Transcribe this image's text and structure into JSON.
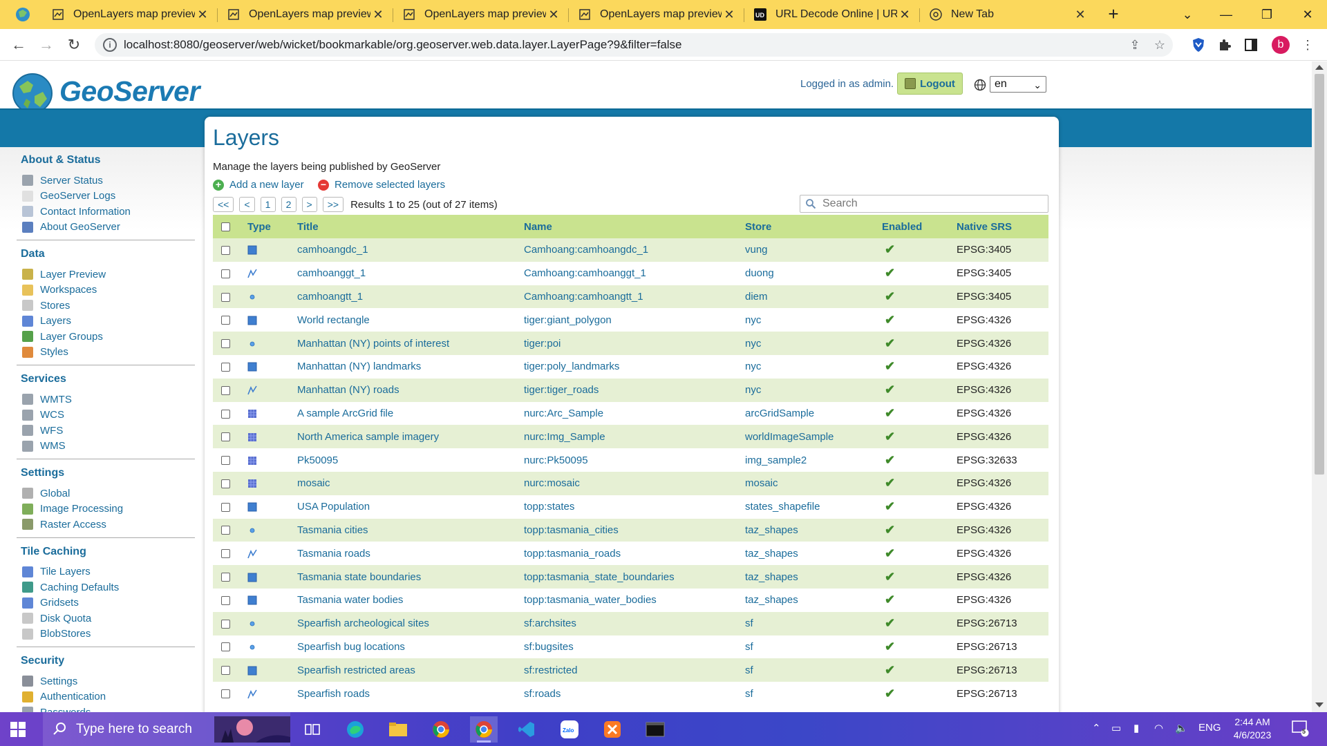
{
  "browser": {
    "tabs": [
      {
        "label": "OpenLayers map preview",
        "active": false
      },
      {
        "label": "OpenLayers map preview",
        "active": false
      },
      {
        "label": "OpenLayers map preview",
        "active": false
      },
      {
        "label": "OpenLayers map preview",
        "active": false
      },
      {
        "label": "URL Decode Online | URLD",
        "active": false
      },
      {
        "label": "New Tab",
        "active": false
      }
    ],
    "url": "localhost:8080/geoserver/web/wicket/bookmarkable/org.geoserver.web.data.layer.LayerPage?9&filter=false",
    "profile_initial": "b"
  },
  "header": {
    "brand": "GeoServer",
    "login_text": "Logged in as admin.",
    "logout_label": "Logout",
    "language": "en"
  },
  "sidebar": {
    "sections": [
      {
        "title": "About & Status",
        "items": [
          {
            "label": "Server Status",
            "icon": "server-status-icon",
            "color": "#9aa3ad"
          },
          {
            "label": "GeoServer Logs",
            "icon": "logs-icon",
            "color": "#e0e0e0"
          },
          {
            "label": "Contact Information",
            "icon": "contact-icon",
            "color": "#b8c4d6"
          },
          {
            "label": "About GeoServer",
            "icon": "about-icon",
            "color": "#5b7fbf"
          }
        ]
      },
      {
        "title": "Data",
        "items": [
          {
            "label": "Layer Preview",
            "icon": "layer-preview-icon",
            "color": "#c9b24a"
          },
          {
            "label": "Workspaces",
            "icon": "workspaces-icon",
            "color": "#e8c25a"
          },
          {
            "label": "Stores",
            "icon": "stores-icon",
            "color": "#c8c8c8"
          },
          {
            "label": "Layers",
            "icon": "layers-icon",
            "color": "#5f86d6"
          },
          {
            "label": "Layer Groups",
            "icon": "layer-groups-icon",
            "color": "#56a14a"
          },
          {
            "label": "Styles",
            "icon": "styles-icon",
            "color": "#e08a3c"
          }
        ]
      },
      {
        "title": "Services",
        "items": [
          {
            "label": "WMTS",
            "icon": "wmts-icon",
            "color": "#9aa3ad"
          },
          {
            "label": "WCS",
            "icon": "wcs-icon",
            "color": "#9aa3ad"
          },
          {
            "label": "WFS",
            "icon": "wfs-icon",
            "color": "#9aa3ad"
          },
          {
            "label": "WMS",
            "icon": "wms-icon",
            "color": "#9aa3ad"
          }
        ]
      },
      {
        "title": "Settings",
        "items": [
          {
            "label": "Global",
            "icon": "global-icon",
            "color": "#b0b0b0"
          },
          {
            "label": "Image Processing",
            "icon": "image-processing-icon",
            "color": "#7fae5a"
          },
          {
            "label": "Raster Access",
            "icon": "raster-access-icon",
            "color": "#8a9a6a"
          }
        ]
      },
      {
        "title": "Tile Caching",
        "items": [
          {
            "label": "Tile Layers",
            "icon": "tile-layers-icon",
            "color": "#5f86d6"
          },
          {
            "label": "Caching Defaults",
            "icon": "caching-defaults-icon",
            "color": "#3f9a8a"
          },
          {
            "label": "Gridsets",
            "icon": "gridsets-icon",
            "color": "#5f86d6"
          },
          {
            "label": "Disk Quota",
            "icon": "disk-quota-icon",
            "color": "#c8c8c8"
          },
          {
            "label": "BlobStores",
            "icon": "blobstores-icon",
            "color": "#c8c8c8"
          }
        ]
      },
      {
        "title": "Security",
        "items": [
          {
            "label": "Settings",
            "icon": "security-settings-icon",
            "color": "#8a8f99"
          },
          {
            "label": "Authentication",
            "icon": "authentication-icon",
            "color": "#e0b030"
          },
          {
            "label": "Passwords",
            "icon": "passwords-icon",
            "color": "#9aa3ad"
          }
        ]
      }
    ]
  },
  "main": {
    "title": "Layers",
    "description": "Manage the layers being published by GeoServer",
    "add_label": "Add a new layer",
    "remove_label": "Remove selected layers",
    "pager": {
      "first": "<<",
      "prev": "<",
      "pages": [
        "1",
        "2"
      ],
      "next": ">",
      "last": ">>"
    },
    "results": "Results 1 to 25 (out of 27 items)",
    "search_placeholder": "Search",
    "columns": [
      "Type",
      "Title",
      "Name",
      "Store",
      "Enabled",
      "Native SRS"
    ],
    "rows": [
      {
        "type": "polygon",
        "title": "camhoangdc_1",
        "name": "Camhoang:camhoangdc_1",
        "store": "vung",
        "srs": "EPSG:3405"
      },
      {
        "type": "line",
        "title": "camhoanggt_1",
        "name": "Camhoang:camhoanggt_1",
        "store": "duong",
        "srs": "EPSG:3405"
      },
      {
        "type": "point",
        "title": "camhoangtt_1",
        "name": "Camhoang:camhoangtt_1",
        "store": "diem",
        "srs": "EPSG:3405"
      },
      {
        "type": "polygon",
        "title": "World rectangle",
        "name": "tiger:giant_polygon",
        "store": "nyc",
        "srs": "EPSG:4326"
      },
      {
        "type": "point",
        "title": "Manhattan (NY) points of interest",
        "name": "tiger:poi",
        "store": "nyc",
        "srs": "EPSG:4326"
      },
      {
        "type": "polygon",
        "title": "Manhattan (NY) landmarks",
        "name": "tiger:poly_landmarks",
        "store": "nyc",
        "srs": "EPSG:4326"
      },
      {
        "type": "line",
        "title": "Manhattan (NY) roads",
        "name": "tiger:tiger_roads",
        "store": "nyc",
        "srs": "EPSG:4326"
      },
      {
        "type": "raster",
        "title": "A sample ArcGrid file",
        "name": "nurc:Arc_Sample",
        "store": "arcGridSample",
        "srs": "EPSG:4326"
      },
      {
        "type": "raster",
        "title": "North America sample imagery",
        "name": "nurc:Img_Sample",
        "store": "worldImageSample",
        "srs": "EPSG:4326"
      },
      {
        "type": "raster",
        "title": "Pk50095",
        "name": "nurc:Pk50095",
        "store": "img_sample2",
        "srs": "EPSG:32633"
      },
      {
        "type": "raster",
        "title": "mosaic",
        "name": "nurc:mosaic",
        "store": "mosaic",
        "srs": "EPSG:4326"
      },
      {
        "type": "polygon",
        "title": "USA Population",
        "name": "topp:states",
        "store": "states_shapefile",
        "srs": "EPSG:4326"
      },
      {
        "type": "point",
        "title": "Tasmania cities",
        "name": "topp:tasmania_cities",
        "store": "taz_shapes",
        "srs": "EPSG:4326"
      },
      {
        "type": "line",
        "title": "Tasmania roads",
        "name": "topp:tasmania_roads",
        "store": "taz_shapes",
        "srs": "EPSG:4326"
      },
      {
        "type": "polygon",
        "title": "Tasmania state boundaries",
        "name": "topp:tasmania_state_boundaries",
        "store": "taz_shapes",
        "srs": "EPSG:4326"
      },
      {
        "type": "polygon",
        "title": "Tasmania water bodies",
        "name": "topp:tasmania_water_bodies",
        "store": "taz_shapes",
        "srs": "EPSG:4326"
      },
      {
        "type": "point",
        "title": "Spearfish archeological sites",
        "name": "sf:archsites",
        "store": "sf",
        "srs": "EPSG:26713"
      },
      {
        "type": "point",
        "title": "Spearfish bug locations",
        "name": "sf:bugsites",
        "store": "sf",
        "srs": "EPSG:26713"
      },
      {
        "type": "polygon",
        "title": "Spearfish restricted areas",
        "name": "sf:restricted",
        "store": "sf",
        "srs": "EPSG:26713"
      },
      {
        "type": "line",
        "title": "Spearfish roads",
        "name": "sf:roads",
        "store": "sf",
        "srs": "EPSG:26713"
      }
    ]
  },
  "taskbar": {
    "search_text": "Type here to search",
    "language": "ENG",
    "time": "2:44 AM",
    "date": "4/6/2023",
    "notification_count": "5"
  },
  "colors": {
    "accent": "#1a6c9b",
    "table_header": "#c9e38f",
    "row_alt": "#e6f0d4",
    "band": "#1478a8",
    "tabstrip": "#fbd85c"
  }
}
